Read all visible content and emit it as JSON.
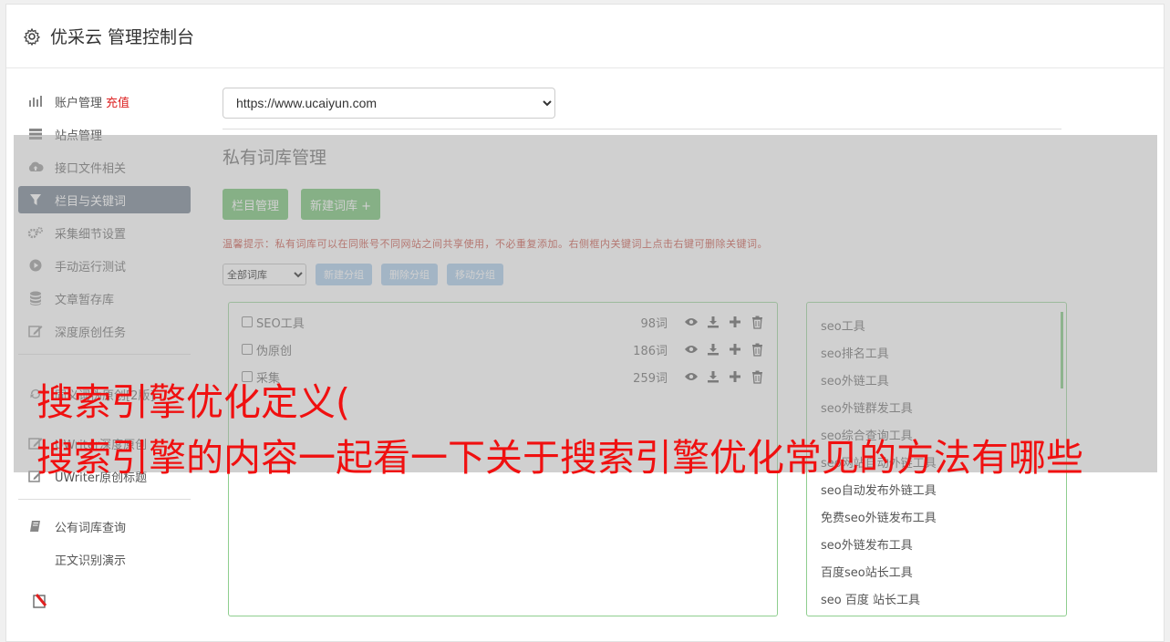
{
  "header": {
    "title": "优采云 管理控制台"
  },
  "sidebar": {
    "items": [
      {
        "label": "账户管理",
        "badge": "充值",
        "icon": "bar-chart-icon"
      },
      {
        "label": "站点管理",
        "icon": "server-icon"
      },
      {
        "label": "接口文件相关",
        "icon": "cloud-upload-icon"
      },
      {
        "label": "栏目与关键词",
        "icon": "filter-icon",
        "active": true
      },
      {
        "label": "采集细节设置",
        "icon": "gears-icon"
      },
      {
        "label": "手动运行测试",
        "icon": "play-circle-icon"
      },
      {
        "label": "文章暂存库",
        "icon": "database-icon"
      },
      {
        "label": "深度原创任务",
        "icon": "edit-icon"
      }
    ],
    "items2": [
      {
        "label": "同义词伪原创[2版]",
        "icon": "refresh-icon"
      },
      {
        "label": "UWriter深度原创",
        "icon": "edit-icon"
      },
      {
        "label": "UWriter原创标题",
        "icon": "edit-icon"
      }
    ],
    "items3": [
      {
        "label": "公有词库查询",
        "icon": "book-icon"
      },
      {
        "label": "正文识别演示",
        "icon": "document-icon"
      }
    ]
  },
  "main": {
    "site_select": "https://www.ucaiyun.com",
    "section_title": "私有词库管理",
    "btn_columns": "栏目管理",
    "btn_new_lib": "新建词库 +",
    "tip": "温馨提示：私有词库可以在同账号不同网站之间共享使用，不必重复添加。右侧框内关键词上点击右键可删除关键词。",
    "group_select": "全部词库",
    "btn_new_group": "新建分组",
    "btn_del_group": "删除分组",
    "btn_move_group": "移动分组",
    "libraries": [
      {
        "name": "SEO工具",
        "count": "98词"
      },
      {
        "name": "伪原创",
        "count": "186词"
      },
      {
        "name": "采集",
        "count": "259词"
      }
    ],
    "keywords": [
      "seo工具",
      "seo排名工具",
      "seo外链工具",
      "seo外链群发工具",
      "seo综合查询工具",
      "seo网站自动外链工具",
      "seo自动发布外链工具",
      "免费seo外链发布工具",
      "seo外链发布工具",
      "百度seo站长工具",
      "seo 百度 站长工具"
    ]
  },
  "overlay": {
    "line1": "搜索引擎优化定义(",
    "line2": "搜索引擎的内容一起看一下关于搜索引擎优化常见的方法有哪些"
  }
}
